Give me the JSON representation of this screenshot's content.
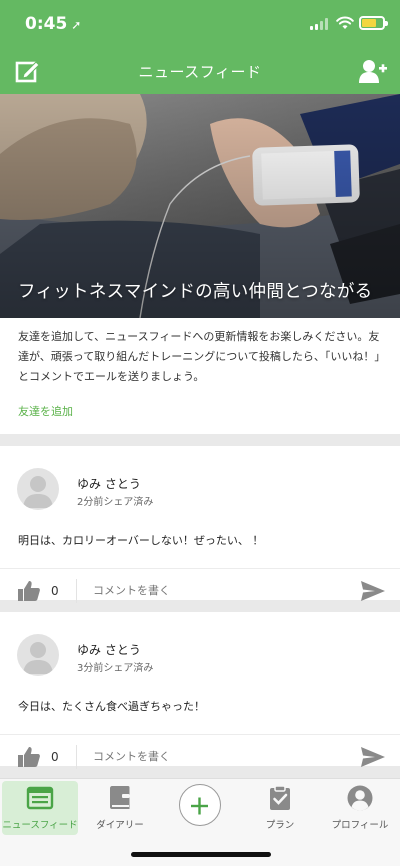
{
  "status_bar": {
    "time": "0:45",
    "location_arrow": "➚"
  },
  "header": {
    "title": "ニュースフィード",
    "left_icon": "compose-icon",
    "right_icon": "add-user-icon"
  },
  "hero": {
    "title": "フィットネスマインドの高い仲間とつながる"
  },
  "intro": {
    "description": "友達を追加して、ニュースフィードへの更新情報をお楽しみください。友達が、頑張って取り組んだトレーニングについて投稿したら、「いいね！」とコメントでエールを送りましょう。",
    "add_friend_link": "友達を追加"
  },
  "posts": [
    {
      "user": "ゆみ さとう",
      "time": "2分前シェア済み",
      "text": "明日は、カロリーオーバーしない！ぜったい、 ！",
      "likes": "0",
      "comment_placeholder": "コメントを書く"
    },
    {
      "user": "ゆみ さとう",
      "time": "3分前シェア済み",
      "text": "今日は、たくさん食べ過ぎちゃった！",
      "likes": "0",
      "comment_placeholder": "コメントを書く"
    }
  ],
  "tabs": [
    {
      "label": "ニュースフィード",
      "icon": "newsfeed-icon",
      "active": true
    },
    {
      "label": "ダイアリー",
      "icon": "diary-icon"
    },
    {
      "label": "",
      "icon": "plus-icon"
    },
    {
      "label": "プラン",
      "icon": "clipboard-icon"
    },
    {
      "label": "プロフィール",
      "icon": "profile-icon"
    }
  ],
  "colors": {
    "brand": "#64b962",
    "link": "#58b147",
    "active_tab_bg": "#d8eed6"
  }
}
